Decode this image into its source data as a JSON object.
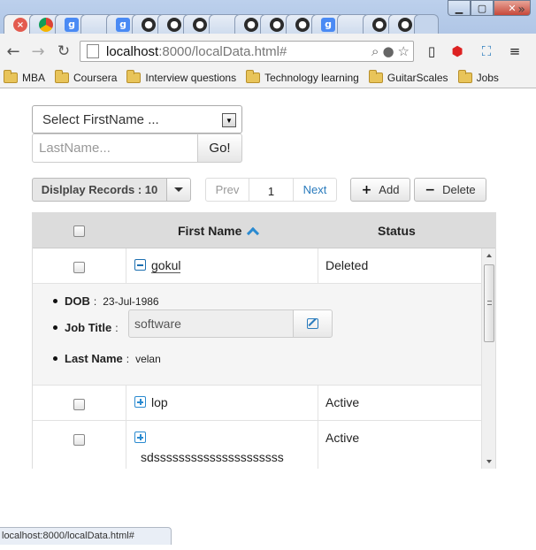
{
  "browser": {
    "tabs": [
      {
        "icon": "close-icon",
        "glyph": "×",
        "style": "close"
      },
      {
        "icon": "chrome-icon",
        "glyph": "",
        "style": "chr"
      },
      {
        "icon": "google-icon",
        "glyph": "g",
        "style": "goo"
      },
      {
        "icon": "blank-tab-icon",
        "glyph": "",
        "style": "blank"
      },
      {
        "icon": "google-icon",
        "glyph": "g",
        "style": "goo"
      },
      {
        "icon": "github-icon",
        "glyph": "●",
        "style": "gh"
      },
      {
        "icon": "github-icon",
        "glyph": "●",
        "style": "gh"
      },
      {
        "icon": "github-icon",
        "glyph": "●",
        "style": "gh"
      },
      {
        "icon": "blank-tab-icon",
        "glyph": "",
        "style": "blank"
      },
      {
        "icon": "github-icon",
        "glyph": "●",
        "style": "gh"
      },
      {
        "icon": "github-icon",
        "glyph": "●",
        "style": "gh"
      },
      {
        "icon": "github-icon",
        "glyph": "●",
        "style": "gh"
      },
      {
        "icon": "google-icon",
        "glyph": "g",
        "style": "goo"
      },
      {
        "icon": "blank-tab-icon",
        "glyph": "",
        "style": "blank"
      },
      {
        "icon": "github-icon",
        "glyph": "●",
        "style": "gh"
      },
      {
        "icon": "github-icon",
        "glyph": "●",
        "style": "gh"
      },
      {
        "icon": "new-tab-icon",
        "glyph": "",
        "style": "blank"
      }
    ],
    "url_host": "localhost",
    "url_rest": ":8000/localData.html#",
    "bookmarks": [
      "MBA",
      "Coursera",
      "Interview questions",
      "Technology learning",
      "GuitarScales",
      "Jobs"
    ],
    "bookmarks_more": "»",
    "status_url": "localhost:8000/localData.html#"
  },
  "filters": {
    "firstname_placeholder": "Select FirstName ...",
    "lastname_placeholder": "LastName...",
    "go_label": "Go!"
  },
  "toolbar": {
    "records_label": "Dislplay Records : 10",
    "prev_label": "Prev",
    "page_number": "1",
    "next_label": "Next",
    "add_label": "Add",
    "delete_label": "Delete"
  },
  "grid": {
    "columns": {
      "first_name": "First Name",
      "status": "Status"
    },
    "sort": "ascending",
    "rows": [
      {
        "first_name": "gokul",
        "status": "Deleted",
        "expanded": true,
        "details": {
          "dob_label": "DOB",
          "dob": "23-Jul-1986",
          "job_label": "Job Title",
          "job_title": "software",
          "last_name_label": "Last Name",
          "last_name": "velan"
        }
      },
      {
        "first_name": "lop",
        "status": "Active",
        "expanded": false
      },
      {
        "first_name": "sdsssssssssssssssssssss",
        "status": "Active",
        "expanded": false
      }
    ]
  },
  "colors": {
    "accent": "#2a8ad0",
    "header_bg": "#dcdcdc",
    "detail_bg": "#f5f5f5"
  }
}
